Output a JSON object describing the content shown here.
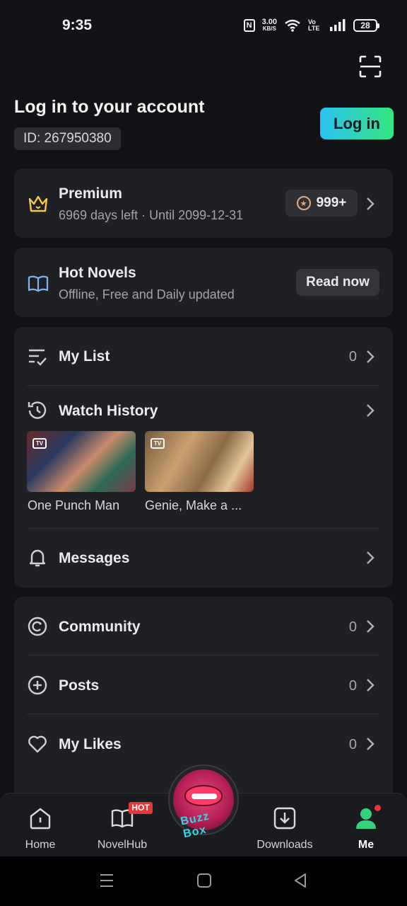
{
  "status_bar": {
    "time": "9:35",
    "nfc": "N",
    "speed": "3.00",
    "speed_unit": "KB/S",
    "volte": "Vo LTE",
    "battery": "28"
  },
  "account": {
    "title": "Log in to your account",
    "id": "ID: 267950380",
    "login_label": "Log in"
  },
  "premium": {
    "title": "Premium",
    "subtitle": "6969 days left · Until 2099-12-31",
    "coins": "999+"
  },
  "novels": {
    "title": "Hot Novels",
    "subtitle": "Offline, Free and Daily updated",
    "button": "Read now"
  },
  "my_list": {
    "label": "My List",
    "count": "0"
  },
  "watch_history": {
    "label": "Watch History",
    "items": [
      {
        "title": "One Punch Man",
        "badge": "TV"
      },
      {
        "title": "Genie, Make a ...",
        "badge": "TV"
      }
    ]
  },
  "messages": {
    "label": "Messages"
  },
  "community": {
    "label": "Community",
    "count": "0"
  },
  "posts": {
    "label": "Posts",
    "count": "0"
  },
  "my_likes": {
    "label": "My Likes",
    "count": "0"
  },
  "bottom_nav": {
    "home": "Home",
    "novelhub": "NovelHub",
    "hot_badge": "HOT",
    "logo_text": "Buzz Box",
    "downloads": "Downloads",
    "me": "Me"
  },
  "colors": {
    "background": "#121316",
    "card": "#1f2024",
    "accent_green": "#33d17a",
    "login_gradient_start": "#2ac2f3",
    "login_gradient_end": "#33e67f",
    "crown": "#f2c94c",
    "book": "#7fb4f0",
    "hot": "#e8373a"
  },
  "icons": [
    "scan-icon",
    "crown-icon",
    "coin-icon",
    "book-icon",
    "list-check-icon",
    "history-icon",
    "bell-icon",
    "community-icon",
    "plus-circle-icon",
    "heart-icon",
    "home-icon",
    "novel-book-icon",
    "download-icon",
    "person-icon",
    "chevron-right-icon"
  ]
}
